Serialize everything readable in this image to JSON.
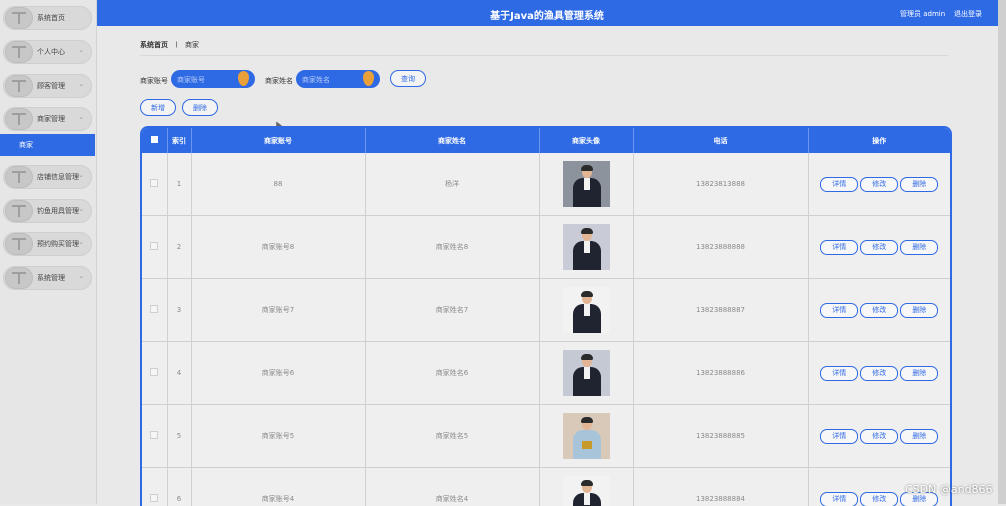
{
  "header": {
    "title": "基于Java的渔具管理系统",
    "user": "管理员 admin",
    "logout": "退出登录"
  },
  "sidebar": {
    "items": [
      {
        "label": "系统首页",
        "chevron": ""
      },
      {
        "label": "个人中心",
        "chevron": "⌄"
      },
      {
        "label": "顾客管理",
        "chevron": "⌄"
      },
      {
        "label": "商家管理",
        "chevron": "⌄"
      },
      {
        "label": "店铺信息管理",
        "chevron": "⌄"
      },
      {
        "label": "钓鱼用具管理",
        "chevron": "⌄"
      },
      {
        "label": "预约购买管理",
        "chevron": "⌄"
      },
      {
        "label": "系统管理",
        "chevron": "⌄"
      }
    ],
    "active_sub": "商家"
  },
  "breadcrumb": {
    "home": "系统首页",
    "separator": "〡",
    "current": "商家"
  },
  "search": {
    "account_label": "商家账号",
    "account_placeholder": "商家账号",
    "name_label": "商家姓名",
    "name_placeholder": "商家姓名",
    "query_button": "查询"
  },
  "actions": {
    "add": "新增",
    "delete": "删除"
  },
  "table": {
    "headers": {
      "index": "索引",
      "account": "商家账号",
      "name": "商家姓名",
      "avatar": "商家头像",
      "phone": "电话",
      "ops": "操作"
    },
    "ops": {
      "detail": "详情",
      "edit": "修改",
      "delete": "删除"
    },
    "rows": [
      {
        "index": "1",
        "account": "88",
        "name": "杨洋",
        "phone": "13823813888"
      },
      {
        "index": "2",
        "account": "商家账号8",
        "name": "商家姓名8",
        "phone": "13823888888"
      },
      {
        "index": "3",
        "account": "商家账号7",
        "name": "商家姓名7",
        "phone": "13823888887"
      },
      {
        "index": "4",
        "account": "商家账号6",
        "name": "商家姓名6",
        "phone": "13823888886"
      },
      {
        "index": "5",
        "account": "商家账号5",
        "name": "商家姓名5",
        "phone": "13823888885"
      },
      {
        "index": "6",
        "account": "商家账号4",
        "name": "商家姓名4",
        "phone": "13823888884"
      }
    ]
  },
  "watermark": "CSDN @and866"
}
